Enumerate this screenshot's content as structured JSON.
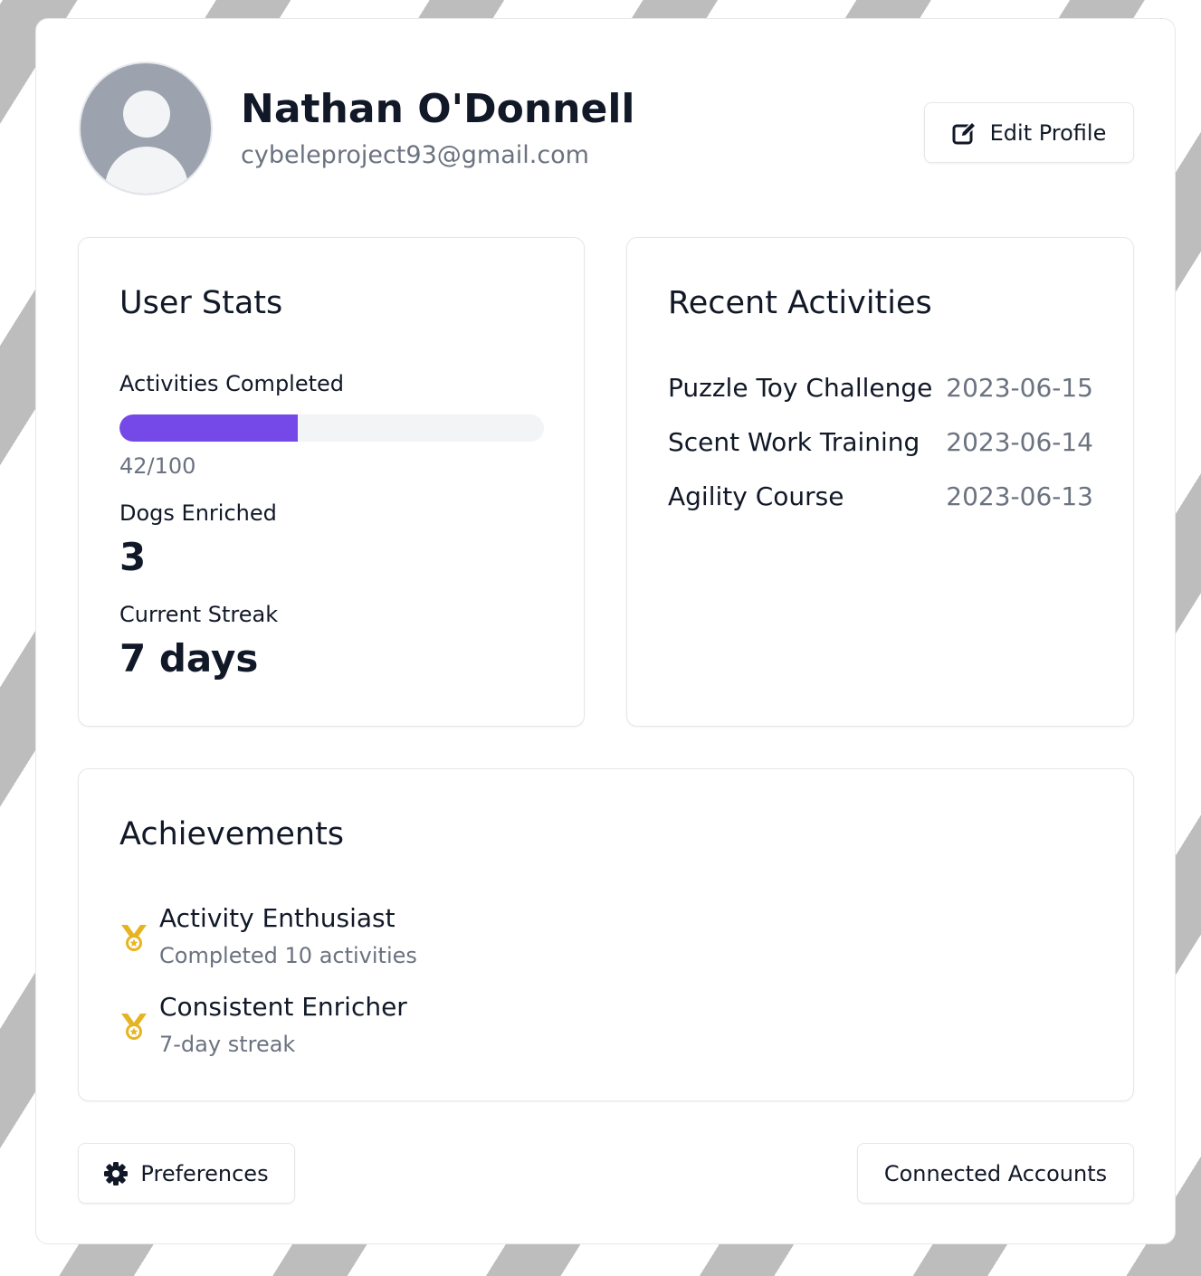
{
  "profile": {
    "name": "Nathan O'Donnell",
    "email": "cybeleproject93@gmail.com",
    "edit_label": "Edit Profile"
  },
  "stats": {
    "title": "User Stats",
    "activities_label": "Activities Completed",
    "activities_done": 42,
    "activities_total": 100,
    "activities_text": "42/100",
    "dogs_label": "Dogs Enriched",
    "dogs_value": "3",
    "streak_label": "Current Streak",
    "streak_value": "7 days"
  },
  "recent": {
    "title": "Recent Activities",
    "items": [
      {
        "name": "Puzzle Toy Challenge",
        "date": "2023-06-15"
      },
      {
        "name": "Scent Work Training",
        "date": "2023-06-14"
      },
      {
        "name": "Agility Course",
        "date": "2023-06-13"
      }
    ]
  },
  "achievements": {
    "title": "Achievements",
    "items": [
      {
        "title": "Activity Enthusiast",
        "desc": "Completed 10 activities",
        "icon": "medal-icon"
      },
      {
        "title": "Consistent Enricher",
        "desc": "7-day streak",
        "icon": "medal-icon"
      }
    ]
  },
  "footer": {
    "preferences_label": "Preferences",
    "connected_label": "Connected Accounts"
  },
  "colors": {
    "accent": "#7549e8",
    "medal": "#e6b422",
    "muted_text": "#6b7280"
  }
}
